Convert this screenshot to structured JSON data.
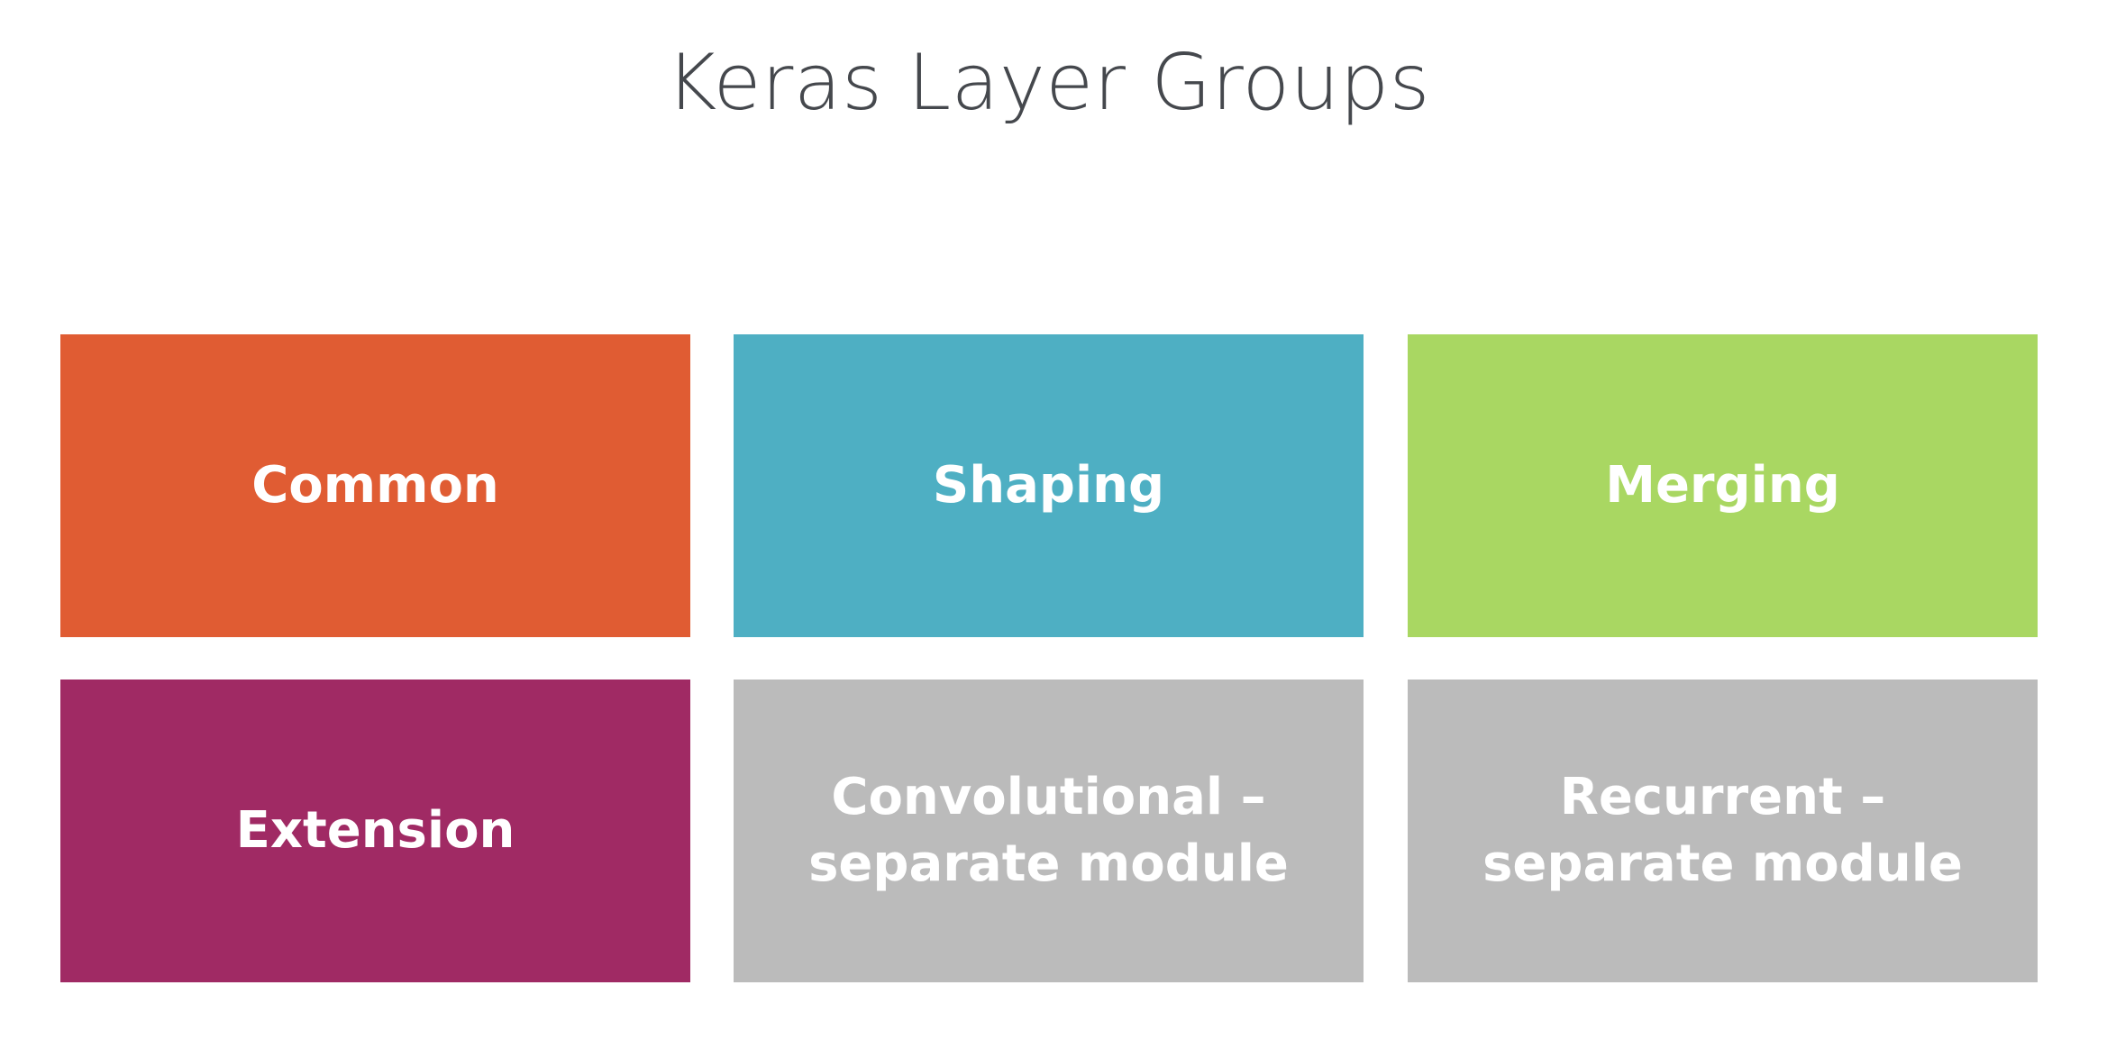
{
  "title": "Keras Layer Groups",
  "tiles": [
    {
      "lines": [
        "Common"
      ],
      "color": "#E05C33"
    },
    {
      "lines": [
        "Shaping"
      ],
      "color": "#4EAFC3"
    },
    {
      "lines": [
        "Merging"
      ],
      "color": "#A9D762"
    },
    {
      "lines": [
        "Extension"
      ],
      "color": "#A02A64"
    },
    {
      "lines": [
        "Convolutional –",
        "separate module"
      ],
      "color": "#BBBBBB"
    },
    {
      "lines": [
        "Recurrent –",
        "separate module"
      ],
      "color": "#BBBBBB"
    }
  ]
}
